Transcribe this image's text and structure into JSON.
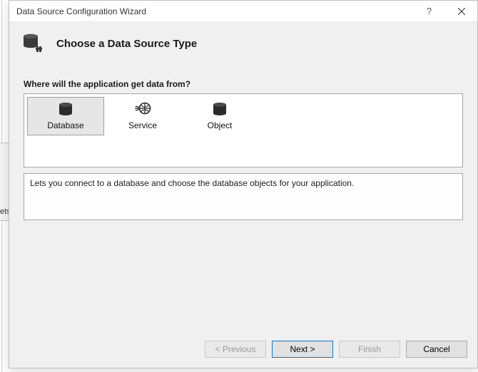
{
  "window": {
    "title": "Data Source Configuration Wizard"
  },
  "header": {
    "heading": "Choose a Data Source Type"
  },
  "background": {
    "tab_fragment": "ets"
  },
  "body": {
    "prompt": "Where will the application get data from?",
    "options": [
      {
        "label": "Database",
        "selected": true
      },
      {
        "label": "Service",
        "selected": false
      },
      {
        "label": "Object",
        "selected": false
      }
    ],
    "description": "Lets you connect to a database and choose the database objects for your application."
  },
  "footer": {
    "previous": "< Previous",
    "next": "Next >",
    "finish": "Finish",
    "cancel": "Cancel"
  }
}
